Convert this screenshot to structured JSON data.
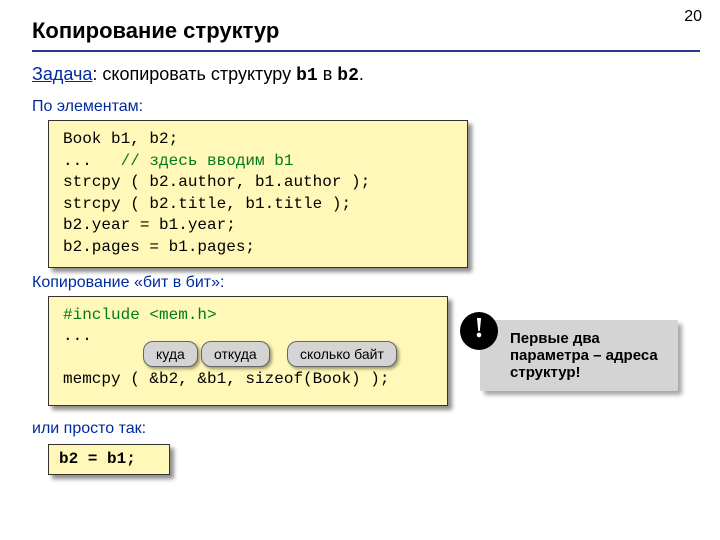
{
  "page_number": "20",
  "title": "Копирование структур",
  "task": {
    "label": "Задача",
    "text_pre": ": скопировать структуру ",
    "var1": "b1",
    "mid": " в ",
    "var2": "b2",
    "end": "."
  },
  "sections": {
    "by_elements": "По элементам:",
    "bit_by_bit": "Копирование «бит в бит»:",
    "simple": "или просто так:"
  },
  "code1": {
    "l1": "Book b1, b2;",
    "l2a": "...   ",
    "l2b": "// здесь вводим b1",
    "l3": "strcpy ( b2.author, b1.author );",
    "l4": "strcpy ( b2.title, b1.title );",
    "l5": "b2.year = b1.year;",
    "l6": "b2.pages = b1.pages;"
  },
  "code2": {
    "l1": "#include <mem.h>",
    "l2": "...",
    "l3": "memcpy ( &b2, &b1, sizeof(Book) );"
  },
  "param_tags": {
    "dest": "куда",
    "src": "откуда",
    "size": "сколько байт"
  },
  "callout": {
    "badge": "!",
    "text": "Первые два параметра – адреса структур!"
  },
  "code3": "b2 = b1;"
}
